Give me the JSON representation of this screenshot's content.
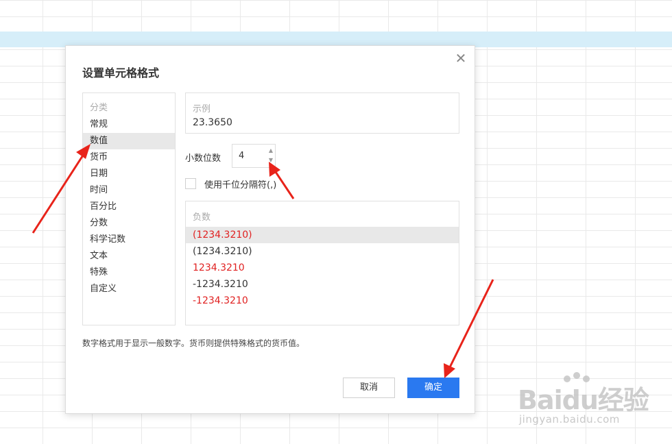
{
  "dialog": {
    "title": "设置单元格格式",
    "close_icon": "close-icon"
  },
  "category": {
    "header": "分类",
    "items": [
      "常规",
      "数值",
      "货币",
      "日期",
      "时间",
      "百分比",
      "分数",
      "科学记数",
      "文本",
      "特殊",
      "自定义"
    ],
    "selected": "数值"
  },
  "sample": {
    "label": "示例",
    "value": "23.3650"
  },
  "decimal": {
    "label": "小数位数",
    "value": "4"
  },
  "thousands_separator": {
    "label": "使用千位分隔符(,)",
    "checked": false
  },
  "negative": {
    "header": "负数",
    "items": [
      {
        "text": "(1234.3210)",
        "color": "#e02020",
        "selected": true
      },
      {
        "text": "(1234.3210)",
        "color": "#333333",
        "selected": false
      },
      {
        "text": "1234.3210",
        "color": "#e02020",
        "selected": false
      },
      {
        "text": "-1234.3210",
        "color": "#333333",
        "selected": false
      },
      {
        "text": "-1234.3210",
        "color": "#e02020",
        "selected": false
      }
    ]
  },
  "description": "数字格式用于显示一般数字。货币则提供特殊格式的货币值。",
  "buttons": {
    "cancel": "取消",
    "ok": "确定"
  },
  "colors": {
    "accent": "#2a79f0",
    "arrow": "#e8231a",
    "row_highlight": "#d6eef9"
  },
  "watermark": {
    "brand": "Baidu经验",
    "url": "jingyan.baidu.com"
  }
}
